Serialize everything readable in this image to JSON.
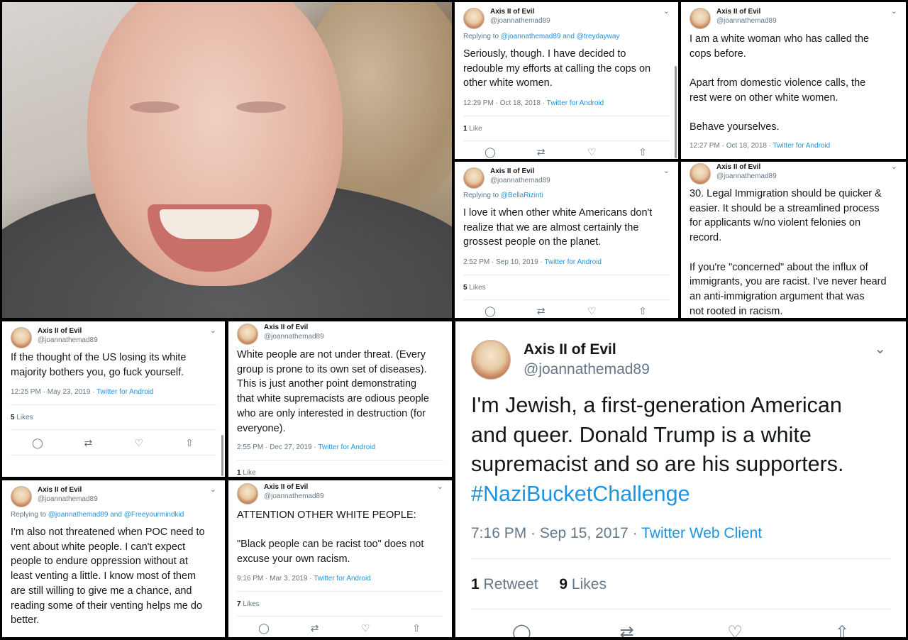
{
  "photo": {
    "description_icon": "selfie-photo"
  },
  "tweets": [
    {
      "name": "Axis II of Evil",
      "handle": "@joannathemad89",
      "reply_prefix": "Replying to ",
      "reply_to": "@joannathemad89 and @treydayway",
      "text": [
        "Seriously, though. I have decided to",
        "redouble my efforts at calling the cops on",
        "other white women."
      ],
      "time": "12:29 PM · Oct 18, 2018 · ",
      "source": "Twitter for Android",
      "likes_num": "1",
      "likes_label": " Like"
    },
    {
      "name": "Axis II of Evil",
      "handle": "@joannathemad89",
      "text": [
        "I am a white woman who has called the",
        "cops before.",
        "",
        "Apart from domestic violence calls, the",
        "rest were on other white women.",
        "",
        "Behave yourselves."
      ],
      "time": "12:27 PM · Oct 18, 2018 · ",
      "source": "Twitter for Android"
    },
    {
      "name": "Axis II of Evil",
      "handle": "@joannathemad89",
      "reply_prefix": "Replying to ",
      "reply_to": "@BellaRizinti",
      "text": [
        "I love it when other white Americans don't",
        "realize that we are almost certainly the",
        "grossest people on the planet."
      ],
      "time": "2:52 PM · Sep 10, 2019 · ",
      "source": "Twitter for Android",
      "likes_num": "5",
      "likes_label": " Likes"
    },
    {
      "name": "Axis II of Evil",
      "handle": "@joannathemad89",
      "text": [
        "30. Legal Immigration should be quicker &",
        "easier. It should be a streamlined process",
        "for applicants w/no violent felonies on",
        "record.",
        "",
        "If you're \"concerned\" about the influx of",
        "immigrants, you are racist. I've never heard",
        "an anti-immigration argument that was",
        "not rooted in racism."
      ]
    },
    {
      "name": "Axis II of Evil",
      "handle": "@joannathemad89",
      "text": [
        "If the thought of the US losing its white",
        "majority bothers you, go fuck yourself."
      ],
      "time": "12:25 PM · May 23, 2019 · ",
      "source": "Twitter for Android",
      "likes_num": "5",
      "likes_label": " Likes"
    },
    {
      "name": "Axis II of Evil",
      "handle": "@joannathemad89",
      "text": [
        "White people are not under threat.  (Every",
        "group is prone to its own set of diseases).",
        "This is just another point demonstrating",
        "that white supremacists are odious people",
        "who are only interested in destruction (for",
        "everyone)."
      ],
      "time": "2:55 PM · Dec 27, 2019 · ",
      "source": "Twitter for Android",
      "likes_num": "1",
      "likes_label": " Like"
    },
    {
      "name": "Axis II of Evil",
      "handle": "@joannathemad89",
      "reply_prefix": "Replying to ",
      "reply_to": "@joannathemad89 and @Freeyourmindkid",
      "text": [
        "I'm also not threatened when POC need to",
        "vent about white people. I can't expect",
        "people to endure oppression without at",
        "least venting a little. I know most of them",
        "are still willing to give me a chance, and",
        "reading some of their venting helps me do",
        "better."
      ]
    },
    {
      "name": "Axis II of Evil",
      "handle": "@joannathemad89",
      "text": [
        "ATTENTION OTHER WHITE PEOPLE:",
        "",
        "\"Black people can be racist too\" does not",
        "excuse your own racism."
      ],
      "time": "9:16 PM · Mar 3, 2019 · ",
      "source": "Twitter for Android",
      "likes_num": "7",
      "likes_label": " Likes"
    }
  ],
  "big_tweet": {
    "name": "Axis II of Evil",
    "handle": "@joannathemad89",
    "text": [
      "I'm Jewish, a first-generation American",
      "and queer.  Donald Trump is a white",
      "supremacist and so are his supporters."
    ],
    "hashtag": "#NaziBucketChallenge",
    "time": "7:16 PM · Sep 15, 2017 · ",
    "source": "Twitter Web Client",
    "retweets_num": "1",
    "retweets_label": " Retweet",
    "likes_num": "9",
    "likes_label": " Likes"
  },
  "icons": {
    "reply": "reply-icon",
    "retweet": "retweet-icon",
    "like": "heart-icon",
    "share": "share-icon",
    "menu": "chevron-down-icon"
  },
  "colors": {
    "link": "#1b95e0",
    "muted": "#657786",
    "text": "#14171a"
  }
}
